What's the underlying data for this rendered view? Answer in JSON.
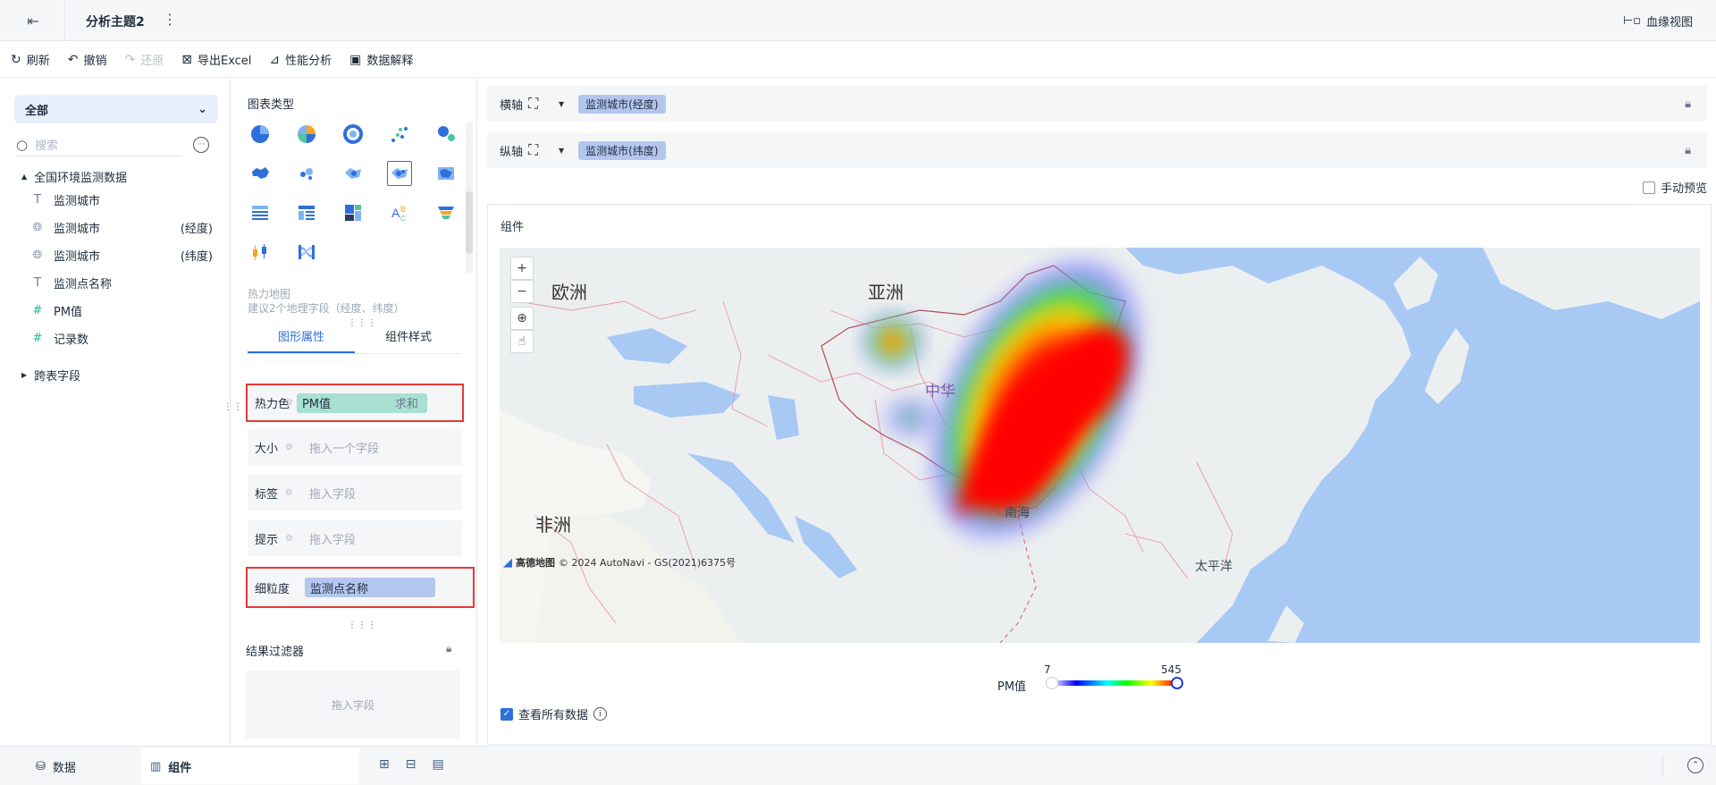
{
  "topbar": {
    "title": "分析主题2",
    "lineage_label": "血缘视图"
  },
  "toolbar": {
    "refresh": "刷新",
    "undo": "撤销",
    "redo": "还原",
    "export": "导出Excel",
    "perf": "性能分析",
    "explain": "数据解释"
  },
  "left": {
    "dataset_select": "全部",
    "search_placeholder": "搜索",
    "tree_root": "全国环境监测数据",
    "fields": [
      {
        "name": "监测城市",
        "suffix": "",
        "type": "text-icon"
      },
      {
        "name": "监测城市",
        "suffix": "(经度)",
        "type": "globe-icon"
      },
      {
        "name": "监测城市",
        "suffix": "(纬度)",
        "type": "globe-icon"
      },
      {
        "name": "监测点名称",
        "suffix": "",
        "type": "text-icon"
      },
      {
        "name": "PM值",
        "suffix": "",
        "type": "number-icon"
      },
      {
        "name": "记录数",
        "suffix": "",
        "type": "number-icon"
      }
    ],
    "cross_table": "跨表字段"
  },
  "middle": {
    "chart_type_label": "图表类型",
    "chart_hint_title": "热力地图",
    "chart_hint_desc": "建议2个地理字段（经度、纬度）",
    "tabs": [
      "图形属性",
      "组件样式"
    ],
    "wells": {
      "heat": {
        "label": "热力色",
        "field": "PM值",
        "agg": "求和"
      },
      "size": {
        "label": "大小",
        "placeholder": "拖入一个字段"
      },
      "tag": {
        "label": "标签",
        "placeholder": "拖入字段"
      },
      "tip": {
        "label": "提示",
        "placeholder": "拖入字段"
      },
      "grain": {
        "label": "细粒度",
        "field": "监测点名称"
      }
    },
    "filter_label": "结果过滤器",
    "filter_placeholder": "拖入字段"
  },
  "right": {
    "x_axis": {
      "label": "横轴",
      "field": "监测城市(经度)"
    },
    "y_axis": {
      "label": "纵轴",
      "field": "监测城市(纬度)"
    },
    "manual_preview": "手动预览",
    "component_label": "组件",
    "map_labels": {
      "europe": "欧洲",
      "asia": "亚洲",
      "africa": "非洲",
      "china": "中华",
      "south_sea": "南海",
      "pacific": "太平洋"
    },
    "attribution": "高德地图",
    "copyright": "© 2024 AutoNavi - GS(2021)6375号",
    "legend": {
      "label": "PM值",
      "min": "7",
      "max": "545"
    },
    "view_all": "查看所有数据"
  },
  "bottom": {
    "tab_data": "数据",
    "tab_component": "组件"
  }
}
